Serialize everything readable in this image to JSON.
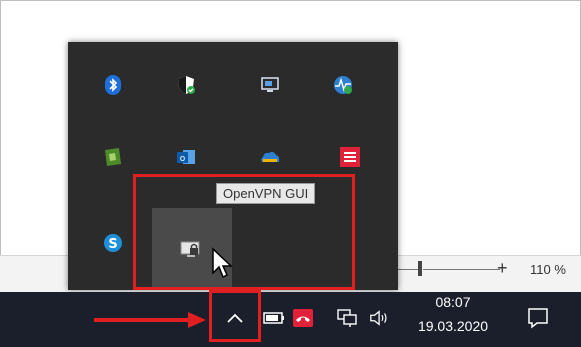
{
  "zoom": {
    "minus": "",
    "plus": "+",
    "level": "110 %"
  },
  "tooltip": {
    "text": "OpenVPN GUI"
  },
  "tray_icons": [
    {
      "name": "bluetooth-icon"
    },
    {
      "name": "windows-security-icon"
    },
    {
      "name": "remote-desktop-icon"
    },
    {
      "name": "network-monitor-icon"
    },
    {
      "name": "greenshot-icon"
    },
    {
      "name": "outlook-icon"
    },
    {
      "name": "onedrive-icon"
    },
    {
      "name": "red-menu-app-icon"
    },
    {
      "name": "skype-icon"
    },
    {
      "name": "openvpn-icon"
    }
  ],
  "taskbar": {
    "clock_time": "08:07",
    "clock_date": "19.03.2020"
  },
  "colors": {
    "taskbar_bg": "#1b1f2b",
    "tray_bg": "#2b2b2b",
    "highlight_red": "#e02020"
  }
}
